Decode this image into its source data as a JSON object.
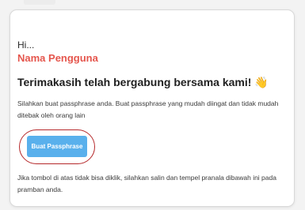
{
  "email": {
    "greeting": "Hi...",
    "username": "Nama Pengguna",
    "heading": "Terimakasih telah bergabung bersama kami!",
    "heading_emoji": "👋",
    "description": "Silahkan buat passphrase anda. Buat passphrase yang mudah diingat dan tidak mudah ditebak oleh orang lain",
    "button_label": "Buat Passphrase",
    "footer": "Jika tombol di atas tidak bisa diklik, silahkan salin dan tempel pranala dibawah ini pada pramban anda."
  },
  "colors": {
    "username": "#e5564d",
    "button": "#59b0ec",
    "highlight_ring": "#b5282a"
  }
}
